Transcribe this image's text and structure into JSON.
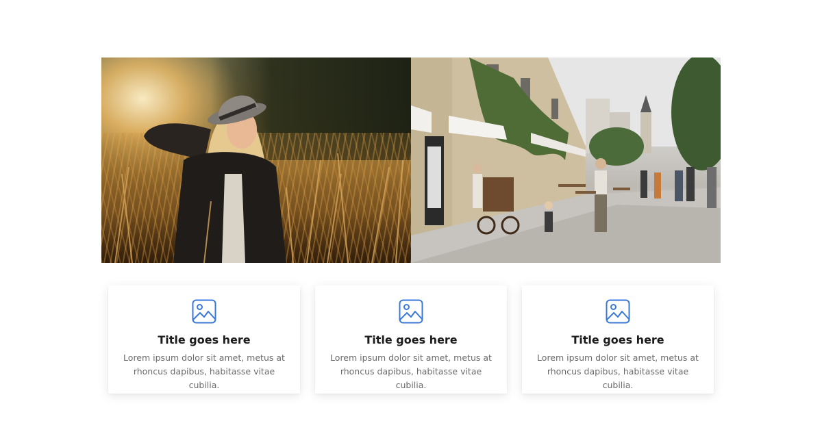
{
  "photos": [
    {
      "name": "woman-in-wheat-field-photo",
      "icon": "photo"
    },
    {
      "name": "town-street-photo",
      "icon": "photo"
    }
  ],
  "cards": [
    {
      "icon": "image-icon",
      "title": "Title goes here",
      "text": "Lorem ipsum dolor sit amet, metus at rhoncus dapibus, habitasse vitae cubilia."
    },
    {
      "icon": "image-icon",
      "title": "Title goes here",
      "text": "Lorem ipsum dolor sit amet, metus at rhoncus dapibus, habitasse vitae cubilia."
    },
    {
      "icon": "image-icon",
      "title": "Title goes here",
      "text": "Lorem ipsum dolor sit amet, metus at rhoncus dapibus, habitasse vitae cubilia."
    }
  ],
  "colors": {
    "accent": "#3a78d8",
    "title": "#1c1c1c",
    "body_text": "#6b6b6b",
    "background": "#ffffff"
  }
}
